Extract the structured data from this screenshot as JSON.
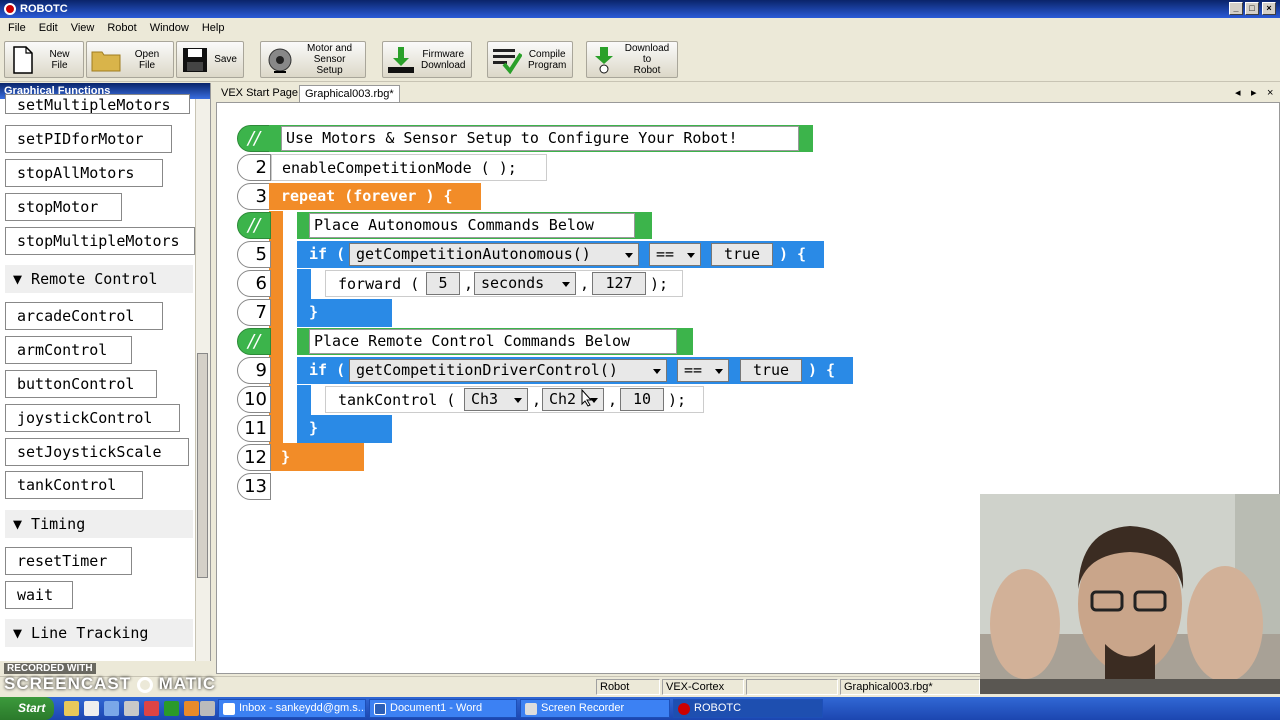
{
  "app": {
    "title": "ROBOTC"
  },
  "menu": [
    "File",
    "Edit",
    "View",
    "Robot",
    "Window",
    "Help"
  ],
  "toolbar": {
    "new_file": "New File",
    "open_file": "Open File",
    "save": "Save",
    "motor_setup_1": "Motor and",
    "motor_setup_2": "Sensor Setup",
    "firmware_1": "Firmware",
    "firmware_2": "Download",
    "compile_1": "Compile",
    "compile_2": "Program",
    "download_1": "Download to",
    "download_2": "Robot"
  },
  "left_panel": {
    "title": "Graphical Functions",
    "items": [
      "setMultipleMotors",
      "setPIDforMotor",
      "stopAllMotors",
      "stopMotor",
      "stopMultipleMotors"
    ],
    "cat_remote": "▼ Remote Control",
    "remote_items": [
      "arcadeControl",
      "armControl",
      "buttonControl",
      "joystickControl",
      "setJoystickScale",
      "tankControl"
    ],
    "cat_timing": "▼ Timing",
    "timing_items": [
      "resetTimer",
      "wait"
    ],
    "cat_line": "▼ Line Tracking"
  },
  "tabs": {
    "start": "VEX Start Page",
    "file": "Graphical003.rbg*"
  },
  "code": {
    "comment_marker": "//",
    "line1_comment": "Use Motors & Sensor Setup to Configure Your Robot!",
    "ln2": "2",
    "line2": "enableCompetitionMode ( );",
    "ln3": "3",
    "line3": "repeat (forever ) {",
    "line4_comment": "Place Autonomous Commands Below",
    "ln5": "5",
    "if_kw": "if (",
    "auto_func": "getCompetitionAutonomous()",
    "eq": "==",
    "true_val": "true",
    "close_brace_open": ") {",
    "ln6": "6",
    "forward": "forward (",
    "forward_num": "5",
    "comma": ",",
    "forward_unit": "seconds",
    "forward_speed": "127",
    "end": ");",
    "ln7": "7",
    "close_brace": "}",
    "line8_comment": "Place Remote Control Commands Below",
    "ln9": "9",
    "driver_func": "getCompetitionDriverControl()",
    "ln10": "10",
    "tank": "tankControl (",
    "ch3": "Ch3",
    "ch2": "Ch2",
    "tank_val": "10",
    "ln11": "11",
    "ln12": "12",
    "ln13": "13"
  },
  "statusbar": {
    "robot": "Robot",
    "platform": "VEX-Cortex",
    "file": "Graphical003.rbg*"
  },
  "taskbar": {
    "start": "Start",
    "items": [
      "Inbox - sankeydd@gm.s...",
      "Document1 - Word",
      "Screen Recorder",
      "ROBOTC"
    ]
  },
  "watermark": {
    "line1": "RECORDED WITH",
    "line2": "SCREENCAST",
    "line3": "MATIC"
  }
}
